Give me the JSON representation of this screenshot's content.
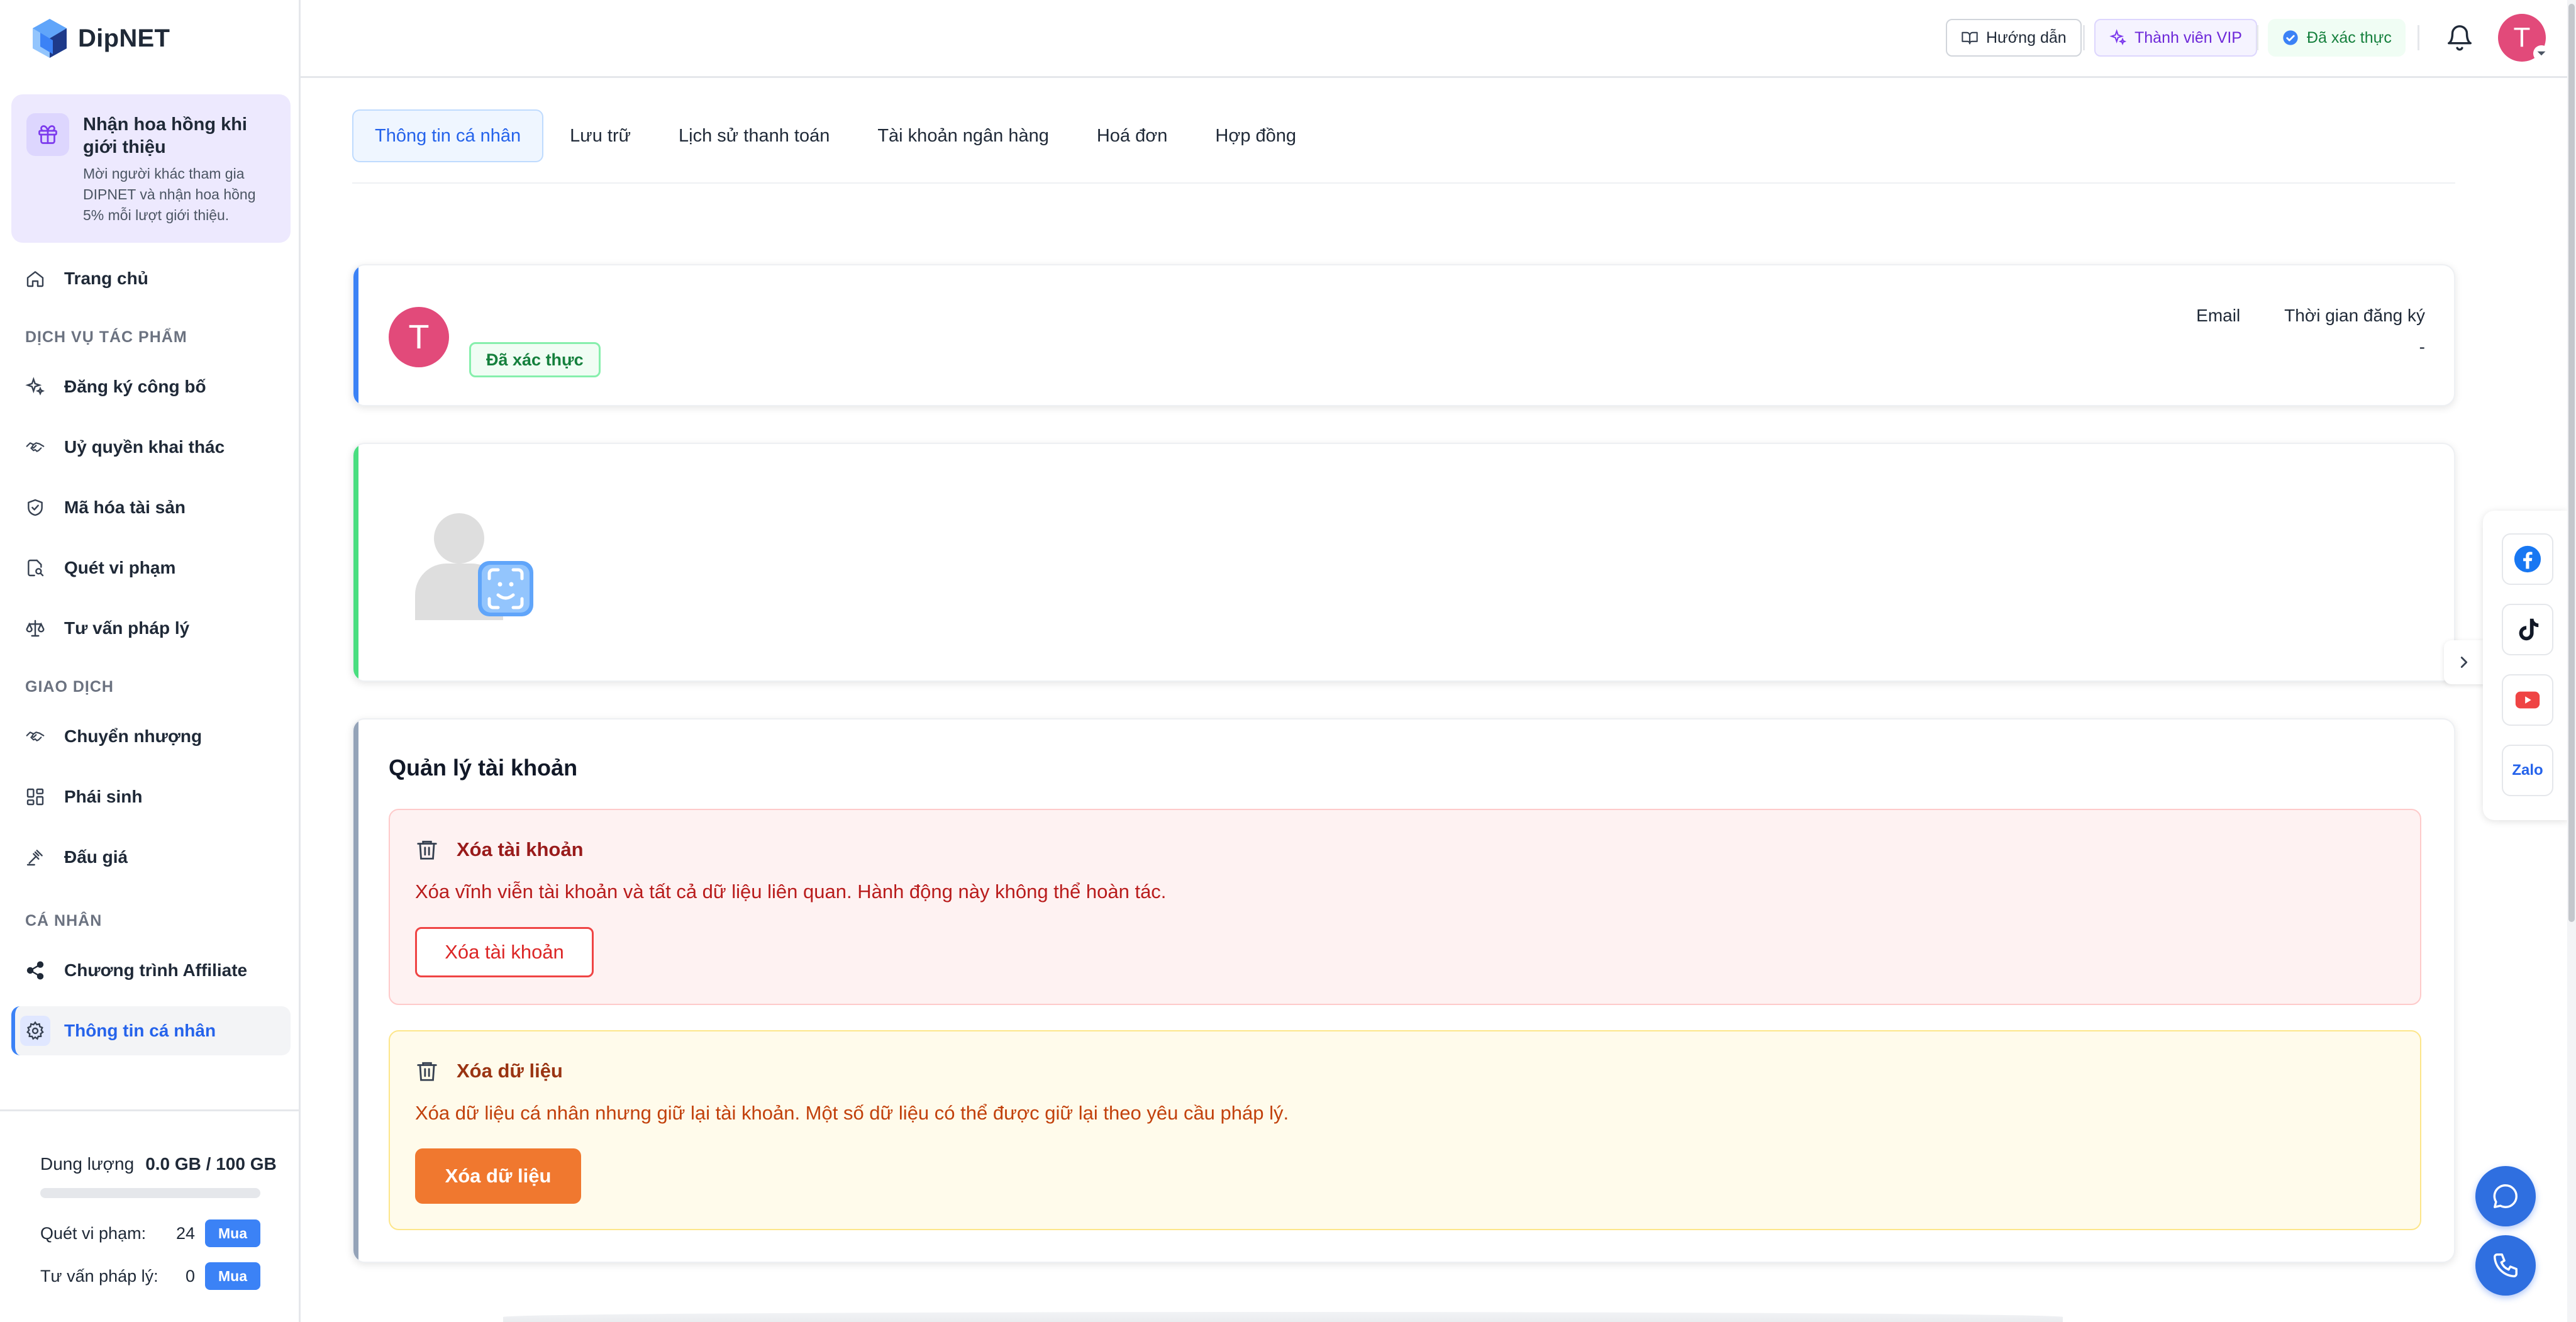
{
  "app": {
    "name": "DipNET"
  },
  "sidebar": {
    "promo": {
      "title": "Nhận hoa hồng khi giới thiệu",
      "description": "Mời người khác tham gia DIPNET và nhận hoa hồng 5% mỗi lượt giới thiệu.",
      "icon": "gift-icon"
    },
    "home": {
      "label": "Trang chủ",
      "icon": "home-icon"
    },
    "sections": [
      {
        "label": "DỊCH VỤ TÁC PHẨM",
        "items": [
          {
            "label": "Đăng ký công bố",
            "icon": "sparkle-icon"
          },
          {
            "label": "Uỷ quyền khai thác",
            "icon": "handshake-icon"
          },
          {
            "label": "Mã hóa tài sản",
            "icon": "shield-check-icon"
          },
          {
            "label": "Quét vi phạm",
            "icon": "scan-search-icon"
          },
          {
            "label": "Tư vấn pháp lý",
            "icon": "scale-icon"
          }
        ]
      },
      {
        "label": "GIAO DỊCH",
        "items": [
          {
            "label": "Chuyển nhượng",
            "icon": "handshake-icon"
          },
          {
            "label": "Phái sinh",
            "icon": "layout-grid-icon"
          },
          {
            "label": "Đấu giá",
            "icon": "gavel-icon"
          }
        ]
      },
      {
        "label": "CÁ NHÂN",
        "items": [
          {
            "label": "Chương trình Affiliate",
            "icon": "share-icon"
          },
          {
            "label": "Thông tin cá nhân",
            "icon": "gear-icon",
            "active": true
          }
        ]
      }
    ],
    "footer": {
      "storage_label": "Dung lượng",
      "storage_value": "0.0 GB / 100 GB",
      "storage_used_fraction": 0,
      "quotas": [
        {
          "label": "Quét vi phạm:",
          "value": "24",
          "button": "Mua"
        },
        {
          "label": "Tư vấn pháp lý:",
          "value": "0",
          "button": "Mua"
        }
      ]
    }
  },
  "topbar": {
    "guide_label": "Hướng dẫn",
    "vip_label": "Thành viên VIP",
    "verified_label": "Đã xác thực",
    "avatar_initial": "T"
  },
  "tabs": [
    {
      "label": "Thông tin cá nhân",
      "active": true
    },
    {
      "label": "Lưu trữ"
    },
    {
      "label": "Lịch sử thanh toán"
    },
    {
      "label": "Tài khoản ngân hàng"
    },
    {
      "label": "Hoá đơn"
    },
    {
      "label": "Hợp đồng"
    }
  ],
  "profile": {
    "avatar_initial": "T",
    "badge": "Đã xác thực",
    "email_label": "Email",
    "email_value": "",
    "registered_label": "Thời gian đăng ký",
    "registered_value": "-"
  },
  "account_management": {
    "title": "Quản lý tài khoản",
    "delete_account": {
      "title": "Xóa tài khoản",
      "description": "Xóa vĩnh viễn tài khoản và tất cả dữ liệu liên quan. Hành động này không thể hoàn tác.",
      "button": "Xóa tài khoản"
    },
    "delete_data": {
      "title": "Xóa dữ liệu",
      "description": "Xóa dữ liệu cá nhân nhưng giữ lại tài khoản. Một số dữ liệu có thể được giữ lại theo yêu cầu pháp lý.",
      "button": "Xóa dữ liệu"
    }
  },
  "social": {
    "zalo_label": "Zalo"
  },
  "colors": {
    "primary": "#3b82f6",
    "avatar": "#e24a7a",
    "danger": "#dc2626",
    "warning": "#f0782f",
    "success": "#15803d"
  }
}
